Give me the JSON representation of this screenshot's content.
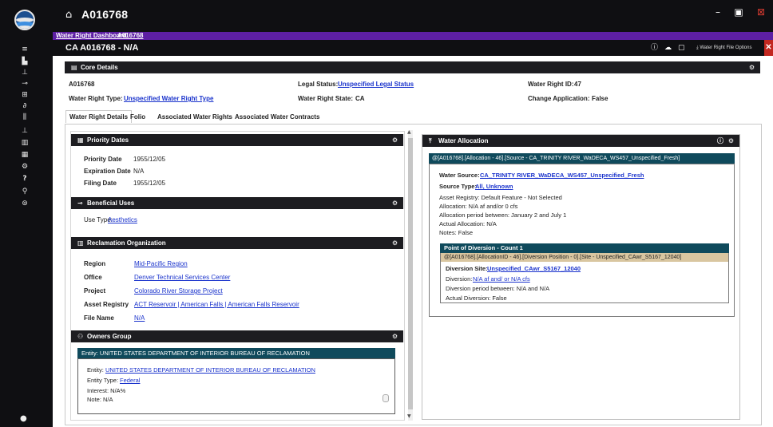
{
  "app": {
    "title": "A016768"
  },
  "breadcrumb": {
    "dashboard": "Water Right Dashboard",
    "record": "A016768"
  },
  "record_bar": {
    "title": "CA A016768 - N/A",
    "options_label": "Water Right File Options"
  },
  "core": {
    "header": "Core Details",
    "id_value": "A016768",
    "type_label": "Water Right Type:",
    "type_value": "Unspecified Water Right Type",
    "legal_label": "Legal Status:",
    "legal_value": "Unspecified Legal Status",
    "state_label": "Water Right State:",
    "state_value": "CA",
    "wrid_label": "Water Right ID:",
    "wrid_value": "47",
    "change_label": "Change Application:",
    "change_value": "False"
  },
  "tabs": [
    {
      "label": "Water Right Details"
    },
    {
      "label": "Folio"
    },
    {
      "label": "Associated Water Rights"
    },
    {
      "label": "Associated Water Contracts"
    }
  ],
  "priority": {
    "header": "Priority Dates",
    "priority_label": "Priority Date",
    "priority_value": "1955/12/05",
    "expiration_label": "Expiration Date",
    "expiration_value": "N/A",
    "filing_label": "Filing Date",
    "filing_value": "1955/12/05"
  },
  "beneficial": {
    "header": "Beneficial Uses",
    "use_type_label": "Use Type:",
    "use_type_value": "Aesthetics"
  },
  "reclamation": {
    "header": "Reclamation Organization",
    "region_label": "Region",
    "region_value": "Mid-Pacific Region",
    "office_label": "Office",
    "office_value": "Denver Technical Services Center",
    "project_label": "Project",
    "project_value": "Colorado River Storage Project",
    "asset_label": "Asset Registry",
    "asset_value": "ACT Reservoir | American Falls | American Falls Reservoir",
    "file_label": "File Name",
    "file_value": "N/A"
  },
  "owners": {
    "header": "Owners Group",
    "entity_header": "Entity: UNITED STATES DEPARTMENT OF INTERIOR BUREAU OF RECLAMATION",
    "entity_label": "Entity:",
    "entity_value": "UNITED STATES DEPARTMENT OF INTERIOR BUREAU OF RECLAMATION",
    "entity_type_label": "Entity Type:",
    "entity_type_value": "Federal",
    "interest": "Interest: N/A%",
    "note": "Note: N/A"
  },
  "allocation": {
    "header": "Water Allocation",
    "source_header": "@[A016768].[Allocation - 46].[Source - CA_TRINITY RIVER_WaDECA_WS457_Unspecified_Fresh]",
    "water_source_label": "Water Source:",
    "water_source_value": "CA_TRINITY RIVER_WaDECA_WS457_Unspecified_Fresh",
    "source_type_label": "Source Type:",
    "source_type_value": "All, Unknown",
    "asset_registry": "Asset Registry: Default Feature - Not Selected",
    "allocation_line": "Allocation: N/A af and/or 0 cfs",
    "period": "Allocation period between: January 2 and July 1",
    "actual": "Actual Allocation: N/A",
    "notes": "Notes: False"
  },
  "diversion": {
    "header": "Point of Diversion - Count 1",
    "subheader": "@[A016768].[AllocationID - 46].[Diversion Position - 0].[Site - Unspecified_CAwr_S5167_12040]",
    "site_label": "Diversion Site:",
    "site_value": "Unspecified_CAwr_S5167_12040",
    "diversion_label": "Diversion:",
    "diversion_value": "N/A af and/ or N/A cfs",
    "period": "Diversion period between: N/A and N/A",
    "actual": "Actual Diversion: False"
  },
  "colors": {
    "chrome": "#0f0f12",
    "accent_purple": "#5d1fa3",
    "teal": "#0f4a5c",
    "diversion_tan": "#d9c6a0",
    "close_red": "#c2271f",
    "link": "#1a33cc"
  },
  "icons": {
    "home": "home-icon",
    "gear": "gear-icon",
    "info": "info-icon",
    "cloud": "cloud-icon",
    "upload": "upload-icon",
    "user": "user-icon"
  }
}
